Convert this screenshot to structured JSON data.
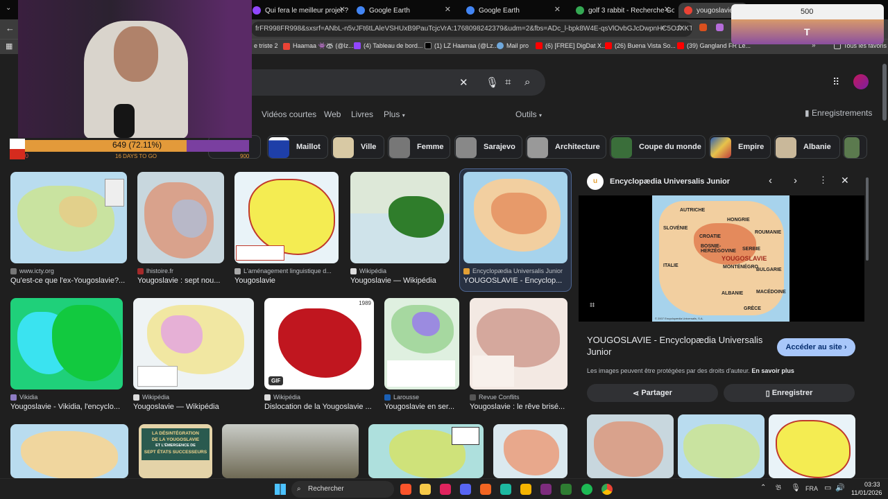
{
  "tabs": [
    {
      "label": "Qui fera le meilleur projet ? (TH",
      "color": "#9146ff"
    },
    {
      "label": "Google Earth",
      "color": "#4285f4"
    },
    {
      "label": "Google Earth",
      "color": "#4285f4"
    },
    {
      "label": "golf 3 rabbit - Recherche Goog",
      "color": "#34a853"
    },
    {
      "label": "yougoslavie - Re",
      "color": "#ea4335"
    }
  ],
  "address": {
    "url": "frFR998FR998&sxsrf=ANbL-n5vJFt6tLAleVSHUxB9PauTcjcVrA:1768098242379&udm=2&fbs=ADc_l-bpk8W4E-qsVlOvbGJcDwpnHC5OJXKT..."
  },
  "bookmarks": [
    "e triste 2",
    "Haamaa 👾🦝 (@lz...",
    "(4) Tableau de bord...",
    "(1) LZ Haamaa (@Lz...",
    "Mail pro",
    "(6) [FREE] DigDat X...",
    "(26) Buena Vista So...",
    "(39) Gangland FR Le..."
  ],
  "bookmarks_all": "Tous les favoris",
  "nav": {
    "short": "Vidéos courtes",
    "web": "Web",
    "books": "Livres",
    "more": "Plus",
    "tools": "Outils",
    "saved": "Enregistrements"
  },
  "chips": [
    "to",
    "Maillot",
    "Ville",
    "Femme",
    "Sarajevo",
    "Architecture",
    "Coupe du monde",
    "Empire",
    "Albanie"
  ],
  "results": [
    {
      "source": "www.icty.org",
      "title": "Qu'est-ce que l'ex-Yougoslavie?..."
    },
    {
      "source": "lhistoire.fr",
      "title": "Yougoslavie : sept nou..."
    },
    {
      "source": "L'aménagement linguistique d...",
      "title": "Yougoslavie"
    },
    {
      "source": "Wikipédia",
      "title": "Yougoslavie — Wikipédia"
    },
    {
      "source": "Encyclopædia Universalis Junior",
      "title": "YOUGOSLAVIE - Encyclop..."
    },
    {
      "source": "Vikidia",
      "title": "Yougoslavie - Vikidia, l'encyclo..."
    },
    {
      "source": "Wikipédia",
      "title": "Yougoslavie — Wikipédia"
    },
    {
      "source": "Wikipédia",
      "title": "Dislocation de la Yougoslavie ..."
    },
    {
      "source": "Larousse",
      "title": "Yougoslavie en ser..."
    },
    {
      "source": "Revue Conflits",
      "title": "Yougoslavie : le rêve brisé..."
    }
  ],
  "gif_badge": "GIF",
  "year_label": "1989",
  "book_text": [
    "LA DÉSINTÉGRATION",
    "DE LA YOUGOSLAVIE",
    "ET L'ÉMERGENCE DE",
    "SEPT ÉTATS SUCCESSEURS"
  ],
  "map_labels": {
    "slovenie": "SLOVÉNIE",
    "croatie": "CROATIE",
    "bosnie": "BOSNIE-HERZÉGOVINE",
    "serbie": "SERBIE",
    "yougo": "YOUGOSLAVIE",
    "monte": "MONTÉNÉGRO",
    "maced": "MACÉDOINE",
    "albanie": "ALBANIE",
    "grece": "GRÈCE",
    "roum": "ROUMANIE",
    "bulg": "BULGARIE",
    "italie": "ITALIE",
    "autriche": "AUTRICHE",
    "hongrie": "HONGRIE"
  },
  "panel": {
    "site": "Encyclopædia Universalis Junior",
    "title": "YOUGOSLAVIE - Encyclopædia Universalis Junior",
    "visit": "Accéder au site",
    "notice": "Les images peuvent être protégées par des droits d'auteur.",
    "learn": "En savoir plus",
    "share": "Partager",
    "save": "Enregistrer",
    "copyright": "© 2007 Encyclopædia Universalis, S.A."
  },
  "stream": {
    "xp": "649 (72.11%)",
    "left": "0",
    "days": "16 DAYS TO GO",
    "right": "900",
    "goal": "500",
    "letter": "T"
  },
  "taskbar": {
    "search": "Rechercher",
    "lang": "FRA",
    "time": "03:33",
    "date": "11/01/2026"
  },
  "colors": {
    "accent": "#8ab4f8",
    "chipbg": "#202124",
    "panelbtn": "#a8c7fa"
  }
}
